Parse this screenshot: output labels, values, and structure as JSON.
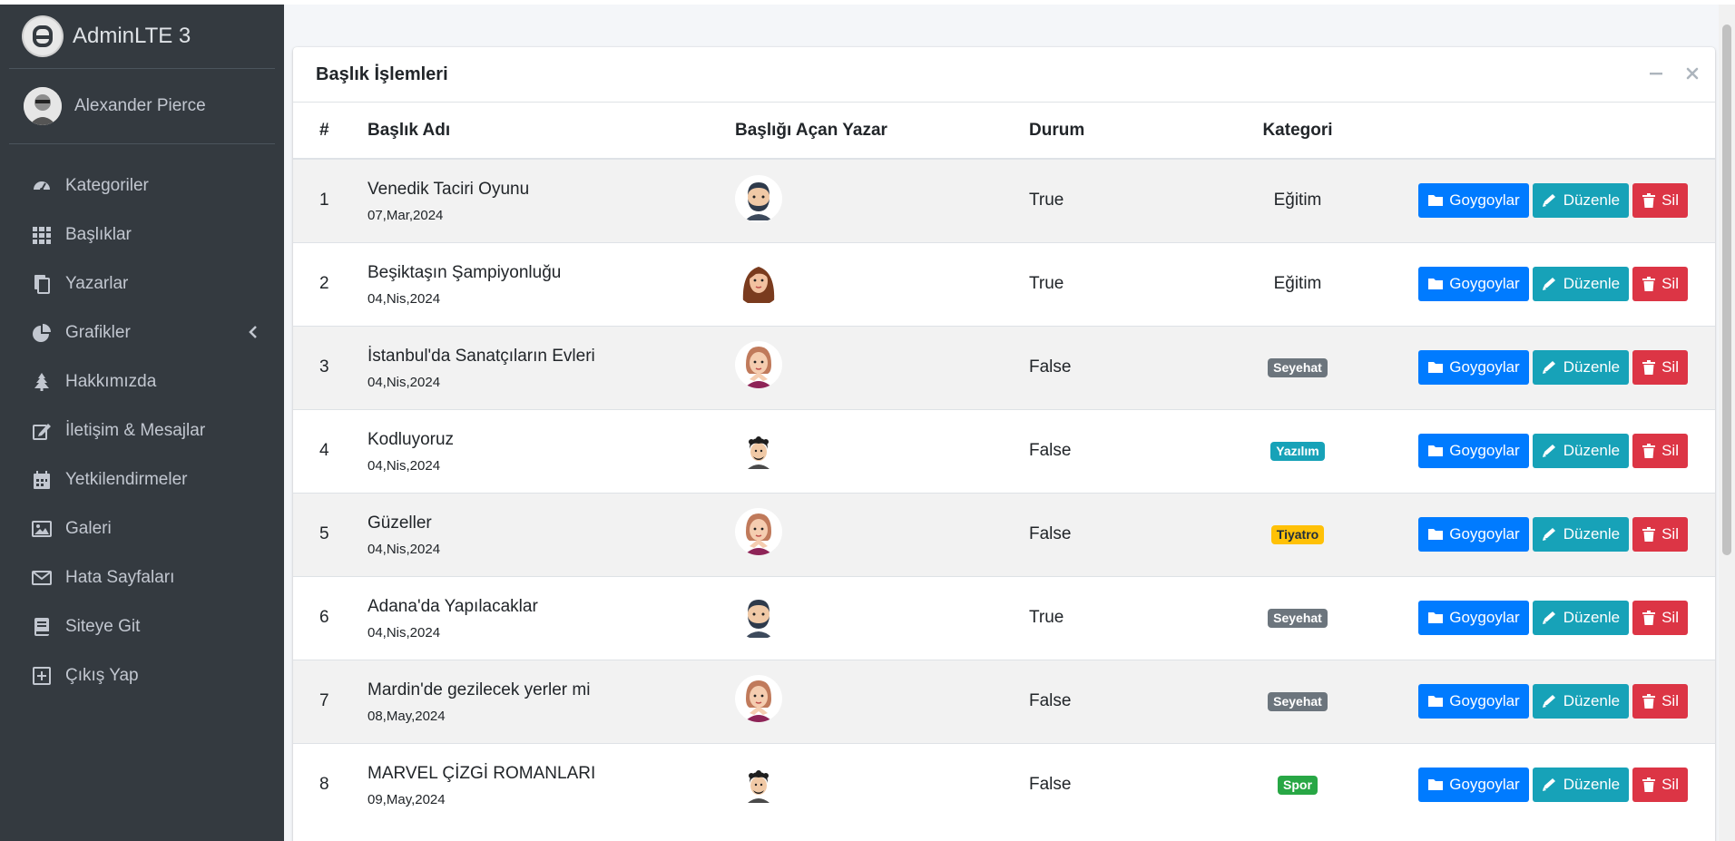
{
  "app": {
    "brand": "AdminLTE 3"
  },
  "user": {
    "name": "Alexander Pierce"
  },
  "sidebar": {
    "items": [
      {
        "label": "Kategoriler",
        "icon": "tachometer-icon"
      },
      {
        "label": "Başlıklar",
        "icon": "grid-icon"
      },
      {
        "label": "Yazarlar",
        "icon": "copy-icon"
      },
      {
        "label": "Grafikler",
        "icon": "pie-chart-icon",
        "has_arrow": true
      },
      {
        "label": "Hakkımızda",
        "icon": "tree-icon"
      },
      {
        "label": "İletişim & Mesajlar",
        "icon": "edit-icon"
      },
      {
        "label": "Yetkilendirmeler",
        "icon": "calendar-icon"
      },
      {
        "label": "Galeri",
        "icon": "image-icon"
      },
      {
        "label": "Hata Sayfaları",
        "icon": "envelope-icon"
      },
      {
        "label": "Siteye Git",
        "icon": "book-icon"
      },
      {
        "label": "Çıkış Yap",
        "icon": "plus-square-icon"
      }
    ]
  },
  "card": {
    "title": "Başlık İşlemleri",
    "columns": {
      "num": "#",
      "title": "Başlık Adı",
      "author": "Başlığı Açan Yazar",
      "status": "Durum",
      "category": "Kategori"
    },
    "buttons": {
      "votes": "Goygoylar",
      "edit": "Düzenle",
      "delete": "Sil"
    },
    "rows": [
      {
        "num": "1",
        "title": "Venedik Taciri Oyunu",
        "date": "07,Mar,2024",
        "avatar": "bearded-man-avatar",
        "status": "True",
        "category": "Eğitim",
        "category_style": "plain"
      },
      {
        "num": "2",
        "title": "Beşiktaşın Şampiyonluğu",
        "date": "04,Nis,2024",
        "avatar": "woman-brown-hair-avatar",
        "status": "True",
        "category": "Eğitim",
        "category_style": "plain"
      },
      {
        "num": "3",
        "title": "İstanbul'da Sanatçıların Evleri",
        "date": "04,Nis,2024",
        "avatar": "woman-hands-on-chin-avatar",
        "status": "False",
        "category": "Seyehat",
        "category_style": "secondary"
      },
      {
        "num": "4",
        "title": "Kodluyoruz",
        "date": "04,Nis,2024",
        "avatar": "man-curly-hair-avatar",
        "status": "False",
        "category": "Yazılım",
        "category_style": "info"
      },
      {
        "num": "5",
        "title": "Güzeller",
        "date": "04,Nis,2024",
        "avatar": "woman-hands-on-chin-avatar",
        "status": "False",
        "category": "Tiyatro",
        "category_style": "warning"
      },
      {
        "num": "6",
        "title": "Adana'da Yapılacaklar",
        "date": "04,Nis,2024",
        "avatar": "bearded-man-avatar",
        "status": "True",
        "category": "Seyehat",
        "category_style": "secondary"
      },
      {
        "num": "7",
        "title": "Mardin'de gezilecek yerler mi",
        "date": "08,May,2024",
        "avatar": "woman-hands-on-chin-avatar",
        "status": "False",
        "category": "Seyehat",
        "category_style": "secondary"
      },
      {
        "num": "8",
        "title": "MARVEL ÇİZGİ ROMANLARI",
        "date": "09,May,2024",
        "avatar": "man-curly-hair-avatar",
        "status": "False",
        "category": "Spor",
        "category_style": "success"
      }
    ]
  },
  "colors": {
    "sidebar_bg": "#343a40",
    "primary": "#007bff",
    "info": "#17a2b8",
    "danger": "#dc3545",
    "secondary": "#6c757d",
    "warning": "#ffc107",
    "success": "#28a745"
  }
}
